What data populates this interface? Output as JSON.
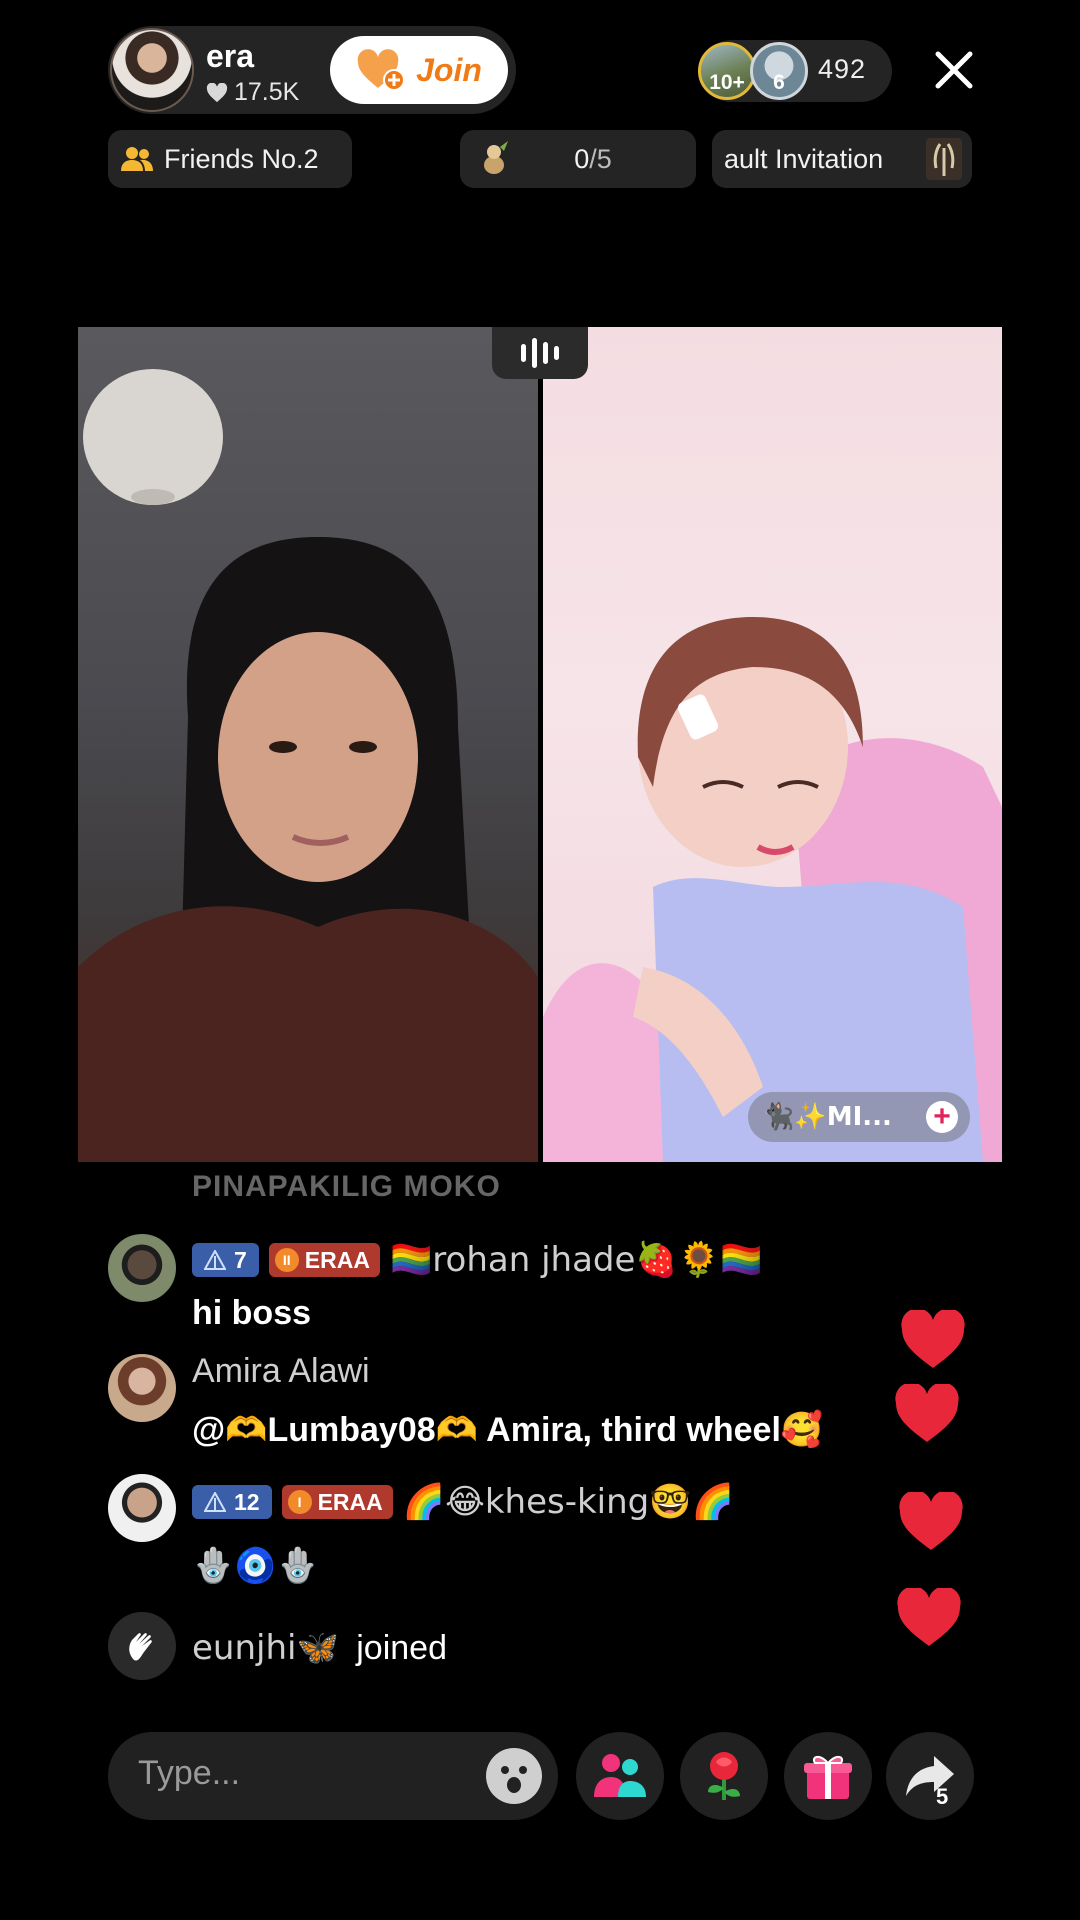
{
  "host": {
    "name": "era",
    "likes": "17.5K",
    "join_label": "Join"
  },
  "viewers": {
    "avatar1_badge": "10+",
    "avatar2_badge": "6",
    "count": "492"
  },
  "chips": {
    "friends": "Friends No.2",
    "goal_current": "0",
    "goal_total": "/5",
    "invitation": "ault Invitation"
  },
  "stream": {
    "guest_label": "🐈‍⬛✨MI..."
  },
  "chat": {
    "faded_line": "PINAPAKILIG MOKO",
    "messages": [
      {
        "level": "7",
        "fan_badge": "ERAA",
        "username": "🏳️‍🌈rohan jhade🍓🌻🏳️‍🌈",
        "text": "hi boss"
      },
      {
        "username": "Amira Alawi",
        "text": "@🫶Lumbay08🫶 Amira, third wheel🥰"
      },
      {
        "level": "12",
        "fan_badge": "ERAA",
        "username": "🌈😂khes-king🤓🌈",
        "text": "🪬🧿🪬"
      }
    ],
    "join_event": {
      "username": "eunjhi🦋",
      "action": "joined"
    }
  },
  "bottom_bar": {
    "placeholder": "Type...",
    "share_count": "5"
  },
  "colors": {
    "accent_orange": "#f07b14",
    "heart_red": "#e8283a",
    "level_badge": "#3a5fa8",
    "fan_badge": "#b0392d"
  }
}
